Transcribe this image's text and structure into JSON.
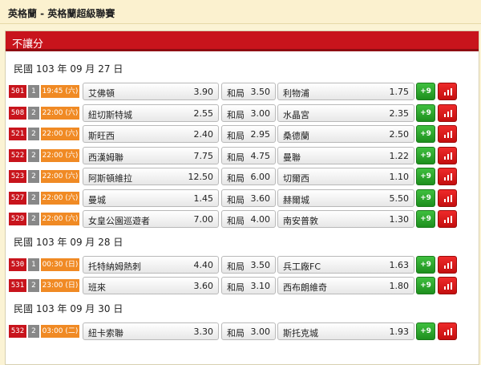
{
  "header": {
    "title": "英格蘭 - 英格蘭超級聯賽"
  },
  "section": {
    "title": "不讓分"
  },
  "draw_label": "和局",
  "groups": [
    {
      "date": "民國 103 年 09 月 27 日",
      "matches": [
        {
          "code": "501",
          "grade": "1",
          "time": "19:45 (六)",
          "home": "艾佛頓",
          "home_odds": "3.90",
          "draw_odds": "3.50",
          "away": "利物浦",
          "away_odds": "1.75",
          "more": "+9"
        },
        {
          "code": "508",
          "grade": "2",
          "time": "22:00 (六)",
          "home": "紐切斯特城",
          "home_odds": "2.55",
          "draw_odds": "3.00",
          "away": "水晶宮",
          "away_odds": "2.35",
          "more": "+9"
        },
        {
          "code": "521",
          "grade": "2",
          "time": "22:00 (六)",
          "home": "斯旺西",
          "home_odds": "2.40",
          "draw_odds": "2.95",
          "away": "桑德蘭",
          "away_odds": "2.50",
          "more": "+9"
        },
        {
          "code": "522",
          "grade": "2",
          "time": "22:00 (六)",
          "home": "西漢姆聯",
          "home_odds": "7.75",
          "draw_odds": "4.75",
          "away": "曼聯",
          "away_odds": "1.22",
          "more": "+9"
        },
        {
          "code": "523",
          "grade": "2",
          "time": "22:00 (六)",
          "home": "阿斯頓維拉",
          "home_odds": "12.50",
          "draw_odds": "6.00",
          "away": "切爾西",
          "away_odds": "1.10",
          "more": "+9"
        },
        {
          "code": "527",
          "grade": "2",
          "time": "22:00 (六)",
          "home": "曼城",
          "home_odds": "1.45",
          "draw_odds": "3.60",
          "away": "赫爾城",
          "away_odds": "5.50",
          "more": "+9"
        },
        {
          "code": "529",
          "grade": "2",
          "time": "22:00 (六)",
          "home": "女皇公園巡遊者",
          "home_odds": "7.00",
          "draw_odds": "4.00",
          "away": "南安普敦",
          "away_odds": "1.30",
          "more": "+9"
        }
      ]
    },
    {
      "date": "民國 103 年 09 月 28 日",
      "matches": [
        {
          "code": "530",
          "grade": "1",
          "time": "00:30 (日)",
          "home": "托特納姆熱刺",
          "home_odds": "4.40",
          "draw_odds": "3.50",
          "away": "兵工廠FC",
          "away_odds": "1.63",
          "more": "+9"
        },
        {
          "code": "531",
          "grade": "2",
          "time": "23:00 (日)",
          "home": "班來",
          "home_odds": "3.60",
          "draw_odds": "3.10",
          "away": "西布朗維奇",
          "away_odds": "1.80",
          "more": "+9"
        }
      ]
    },
    {
      "date": "民國 103 年 09 月 30 日",
      "matches": [
        {
          "code": "532",
          "grade": "2",
          "time": "03:00 (二)",
          "home": "紐卡索聯",
          "home_odds": "3.30",
          "draw_odds": "3.00",
          "away": "斯托克城",
          "away_odds": "1.93",
          "more": "+9"
        }
      ]
    }
  ]
}
